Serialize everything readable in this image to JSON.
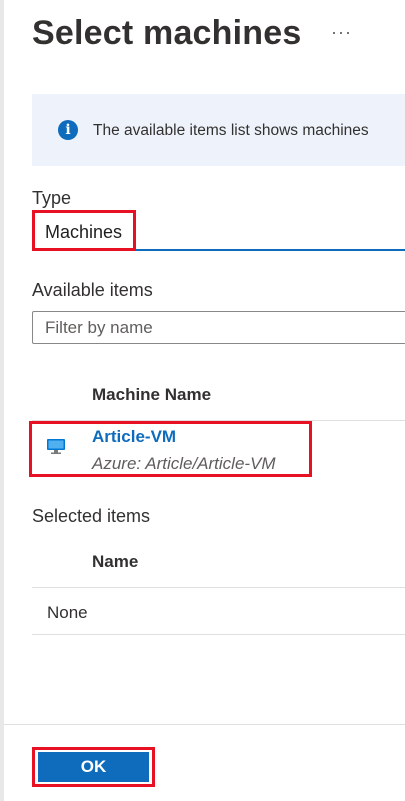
{
  "page": {
    "title": "Select machines",
    "more_label": "···"
  },
  "info": {
    "icon": "info-icon",
    "icon_glyph": "i",
    "text": "The available items list shows machines"
  },
  "type": {
    "label": "Type",
    "value": "Machines"
  },
  "available": {
    "label": "Available items",
    "filter_placeholder": "Filter by name",
    "column": "Machine Name",
    "items": [
      {
        "name": "Article-VM",
        "subtitle": "Azure: Article/Article-VM",
        "icon": "virtual-machine-icon"
      }
    ]
  },
  "selected": {
    "label": "Selected items",
    "column": "Name",
    "empty_text": "None"
  },
  "footer": {
    "ok_label": "OK"
  },
  "colors": {
    "accent": "#0f6cbd",
    "highlight": "#e81123",
    "info_bg": "#eef3fb"
  }
}
